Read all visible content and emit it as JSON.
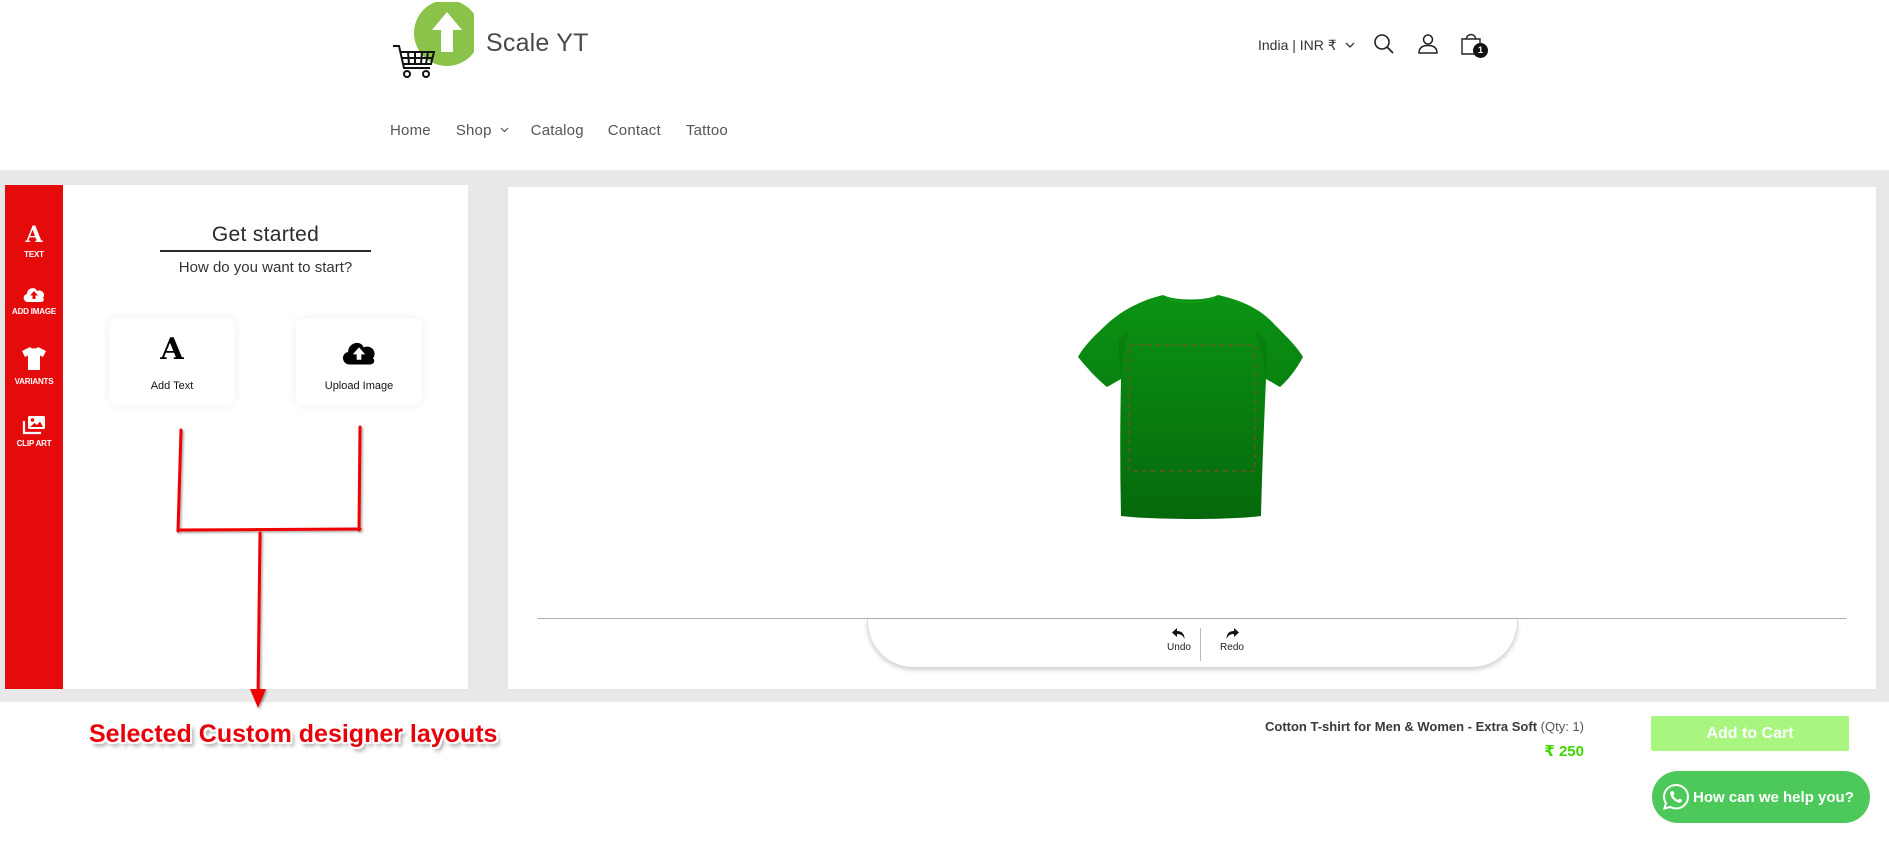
{
  "header": {
    "brand_name": "Scale YT",
    "logo_icon": "upload-arrow-cart-logo",
    "locale": "India | INR ₹",
    "search_icon": "search-icon",
    "account_icon": "account-icon",
    "cart_icon": "cart-bag-icon",
    "cart_count": "1"
  },
  "nav": {
    "items": [
      {
        "label": "Home"
      },
      {
        "label": "Shop",
        "has_dropdown": true
      },
      {
        "label": "Catalog"
      },
      {
        "label": "Contact"
      },
      {
        "label": "Tattoo"
      }
    ]
  },
  "designer": {
    "sidebar": [
      {
        "label": "TEXT",
        "icon": "text-icon"
      },
      {
        "label": "ADD IMAGE",
        "icon": "cloud-upload-icon"
      },
      {
        "label": "VARIANTS",
        "icon": "tshirt-icon"
      },
      {
        "label": "CLIP ART",
        "icon": "images-icon"
      }
    ],
    "panel": {
      "title": "Get started",
      "subtitle": "How do you want to start?",
      "options": [
        {
          "label": "Add Text",
          "icon": "text-icon"
        },
        {
          "label": "Upload Image",
          "icon": "cloud-upload-icon"
        }
      ]
    },
    "canvas": {
      "product_view": "T-shirt back view",
      "toolbar": [
        {
          "label": "Undo",
          "icon": "undo-icon"
        },
        {
          "label": "Redo",
          "icon": "redo-icon"
        }
      ]
    }
  },
  "product": {
    "name": "Cotton T-shirt for Men & Women - Extra Soft",
    "qty": "(Qty: 1)",
    "price": "₹ 250",
    "add_to_cart_label": "Add to Cart"
  },
  "chat": {
    "label": "How can we help you?",
    "icon": "whatsapp-icon"
  },
  "annotation": {
    "text": "Selected Custom designer layouts"
  },
  "colors": {
    "brand_green": "#8bc34a",
    "sidebar_red": "#e60b0b",
    "shirt_green": "#0a8a10",
    "price_green": "#3fd600",
    "add_to_cart_bg": "#a8f57f",
    "chat_bg": "#4cc95a",
    "annotation_red": "#e8000a",
    "band_gray": "#e8e8e9"
  }
}
